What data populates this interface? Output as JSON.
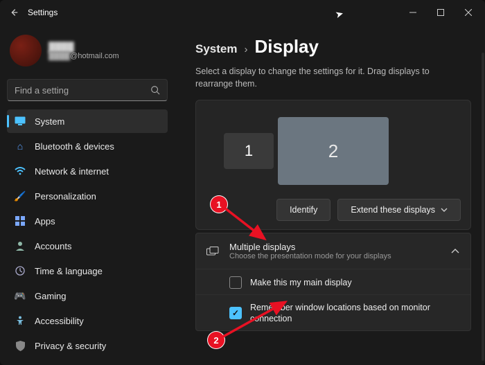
{
  "titlebar": {
    "title": "Settings"
  },
  "profile": {
    "name": "████",
    "email_prefix": "████",
    "email_suffix": "@hotmail.com"
  },
  "search": {
    "placeholder": "Find a setting"
  },
  "sidebar": {
    "items": [
      {
        "label": "System"
      },
      {
        "label": "Bluetooth & devices"
      },
      {
        "label": "Network & internet"
      },
      {
        "label": "Personalization"
      },
      {
        "label": "Apps"
      },
      {
        "label": "Accounts"
      },
      {
        "label": "Time & language"
      },
      {
        "label": "Gaming"
      },
      {
        "label": "Accessibility"
      },
      {
        "label": "Privacy & security"
      }
    ]
  },
  "breadcrumb": {
    "parent": "System",
    "sep": "›",
    "current": "Display"
  },
  "subtitle": "Select a display to change the settings for it. Drag displays to rearrange them.",
  "monitors": {
    "m1": "1",
    "m2": "2"
  },
  "actions": {
    "identify": "Identify",
    "extend": "Extend these displays"
  },
  "multiple_displays": {
    "title": "Multiple displays",
    "subtitle": "Choose the presentation mode for your displays",
    "opt_main": "Make this my main display",
    "opt_remember": "Remember window locations based on monitor connection"
  },
  "annotations": {
    "b1": "1",
    "b2": "2"
  }
}
